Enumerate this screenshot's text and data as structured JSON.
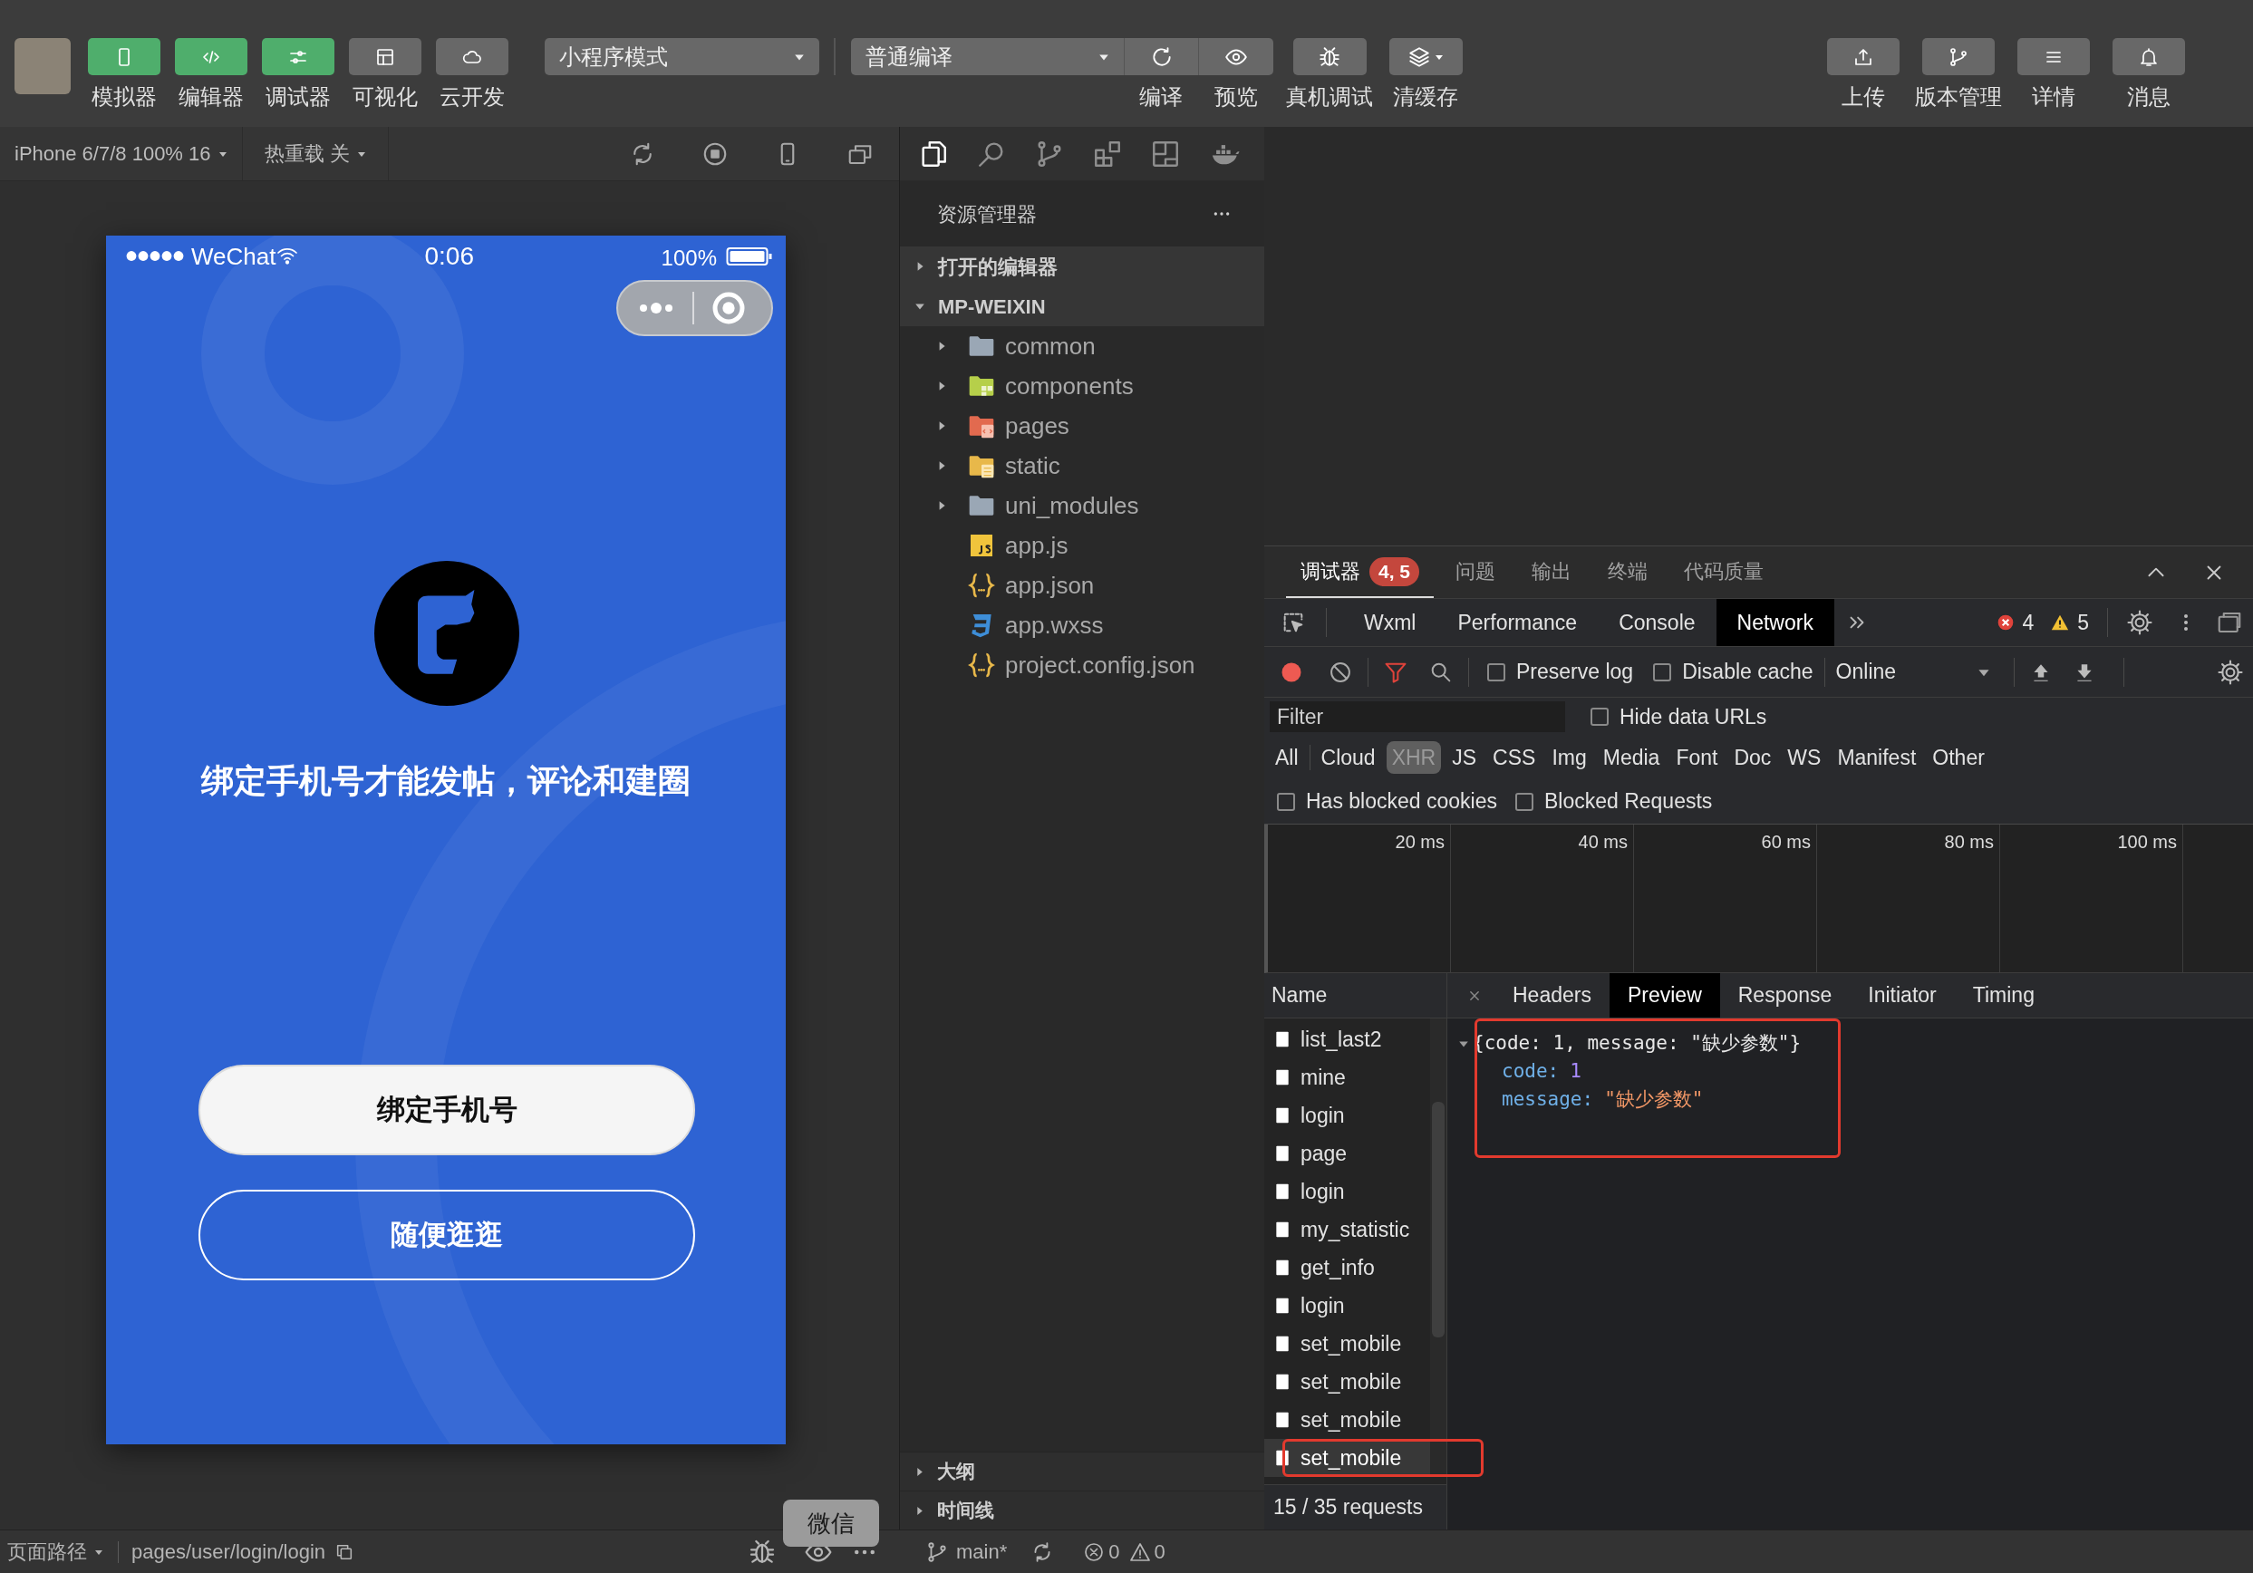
{
  "toolbar": {
    "view_buttons": [
      {
        "label": "模拟器",
        "on": true
      },
      {
        "label": "编辑器",
        "on": true
      },
      {
        "label": "调试器",
        "on": true
      },
      {
        "label": "可视化",
        "on": false
      },
      {
        "label": "云开发",
        "on": false
      }
    ],
    "mode_select": "小程序模式",
    "compile_select": "普通编译",
    "actions": [
      "编译",
      "预览",
      "真机调试",
      "清缓存"
    ],
    "right_buttons": [
      "上传",
      "版本管理",
      "详情",
      "消息"
    ]
  },
  "simulator": {
    "device": "iPhone 6/7/8 100% 16",
    "hot_reload": "热重载 关",
    "phone": {
      "carrier": "WeChat",
      "time": "0:06",
      "battery": "100%",
      "headline": "绑定手机号才能发帖，评论和建圈",
      "buttons": [
        {
          "label": "绑定手机号",
          "kind": "filled"
        },
        {
          "label": "随便逛逛",
          "kind": "outline"
        }
      ]
    }
  },
  "explorer": {
    "title": "资源管理器",
    "sections": [
      {
        "label": "打开的编辑器",
        "expanded": false
      },
      {
        "label": "MP-WEIXIN",
        "expanded": true,
        "children": [
          {
            "name": "common",
            "kind": "folder",
            "expanded": false
          },
          {
            "name": "components",
            "kind": "components-folder",
            "expanded": false
          },
          {
            "name": "pages",
            "kind": "pages-folder",
            "expanded": false
          },
          {
            "name": "static",
            "kind": "static-folder",
            "expanded": false
          },
          {
            "name": "uni_modules",
            "kind": "folder",
            "expanded": false
          },
          {
            "name": "app.js",
            "kind": "js"
          },
          {
            "name": "app.json",
            "kind": "json"
          },
          {
            "name": "app.wxss",
            "kind": "wxss"
          },
          {
            "name": "project.config.json",
            "kind": "json"
          }
        ]
      }
    ],
    "panels": [
      {
        "label": "大纲",
        "expanded": false
      },
      {
        "label": "时间线",
        "expanded": false
      }
    ]
  },
  "debugger": {
    "tabs": [
      {
        "label": "调试器",
        "selected": true,
        "badge": "4, 5"
      },
      {
        "label": "问题",
        "selected": false
      },
      {
        "label": "输出",
        "selected": false
      },
      {
        "label": "终端",
        "selected": false
      },
      {
        "label": "代码质量",
        "selected": false
      }
    ],
    "panel_tabs": [
      {
        "label": "Wxml",
        "selected": false
      },
      {
        "label": "Performance",
        "selected": false
      },
      {
        "label": "Console",
        "selected": false
      },
      {
        "label": "Network",
        "selected": true
      }
    ],
    "error_count": "4",
    "warning_count": "5",
    "network": {
      "recording": true,
      "toolbar_options": [
        {
          "label": "Preserve log",
          "checked": false
        },
        {
          "label": "Disable cache",
          "checked": false
        }
      ],
      "throttling": "Online",
      "filter": {
        "placeholder": "Filter"
      },
      "filter_options": [
        {
          "label": "Hide data URLs",
          "checked": false
        }
      ],
      "types": [
        {
          "label": "All",
          "selected": false
        },
        {
          "label": "Cloud",
          "selected": false
        },
        {
          "label": "XHR",
          "selected": true
        },
        {
          "label": "JS",
          "selected": false
        },
        {
          "label": "CSS",
          "selected": false
        },
        {
          "label": "Img",
          "selected": false
        },
        {
          "label": "Media",
          "selected": false
        },
        {
          "label": "Font",
          "selected": false
        },
        {
          "label": "Doc",
          "selected": false
        },
        {
          "label": "WS",
          "selected": false
        },
        {
          "label": "Manifest",
          "selected": false
        },
        {
          "label": "Other",
          "selected": false
        }
      ],
      "blocked_options": [
        {
          "label": "Has blocked cookies",
          "checked": false
        },
        {
          "label": "Blocked Requests",
          "checked": false
        }
      ],
      "timeline_ticks": [
        "20 ms",
        "40 ms",
        "60 ms",
        "80 ms",
        "100 ms"
      ],
      "name_column": "Name",
      "requests": [
        {
          "name": "list_last2",
          "selected": false,
          "highlighted": false
        },
        {
          "name": "mine",
          "selected": false,
          "highlighted": false
        },
        {
          "name": "login",
          "selected": false,
          "highlighted": false
        },
        {
          "name": "page",
          "selected": false,
          "highlighted": false
        },
        {
          "name": "login",
          "selected": false,
          "highlighted": false
        },
        {
          "name": "my_statistic",
          "selected": false,
          "highlighted": false
        },
        {
          "name": "get_info",
          "selected": false,
          "highlighted": false
        },
        {
          "name": "login",
          "selected": false,
          "highlighted": false
        },
        {
          "name": "set_mobile",
          "selected": false,
          "highlighted": false
        },
        {
          "name": "set_mobile",
          "selected": false,
          "highlighted": false
        },
        {
          "name": "set_mobile",
          "selected": false,
          "highlighted": false
        },
        {
          "name": "set_mobile",
          "selected": true,
          "highlighted": true
        }
      ],
      "summary": "15 / 35 requests",
      "detail_tabs": [
        {
          "label": "Headers",
          "selected": false
        },
        {
          "label": "Preview",
          "selected": true
        },
        {
          "label": "Response",
          "selected": false
        },
        {
          "label": "Initiator",
          "selected": false
        },
        {
          "label": "Timing",
          "selected": false
        }
      ],
      "preview": {
        "summary": "{code: 1, message: \"缺少参数\"}",
        "expanded": true,
        "highlighted": true,
        "fields": [
          {
            "key": "code:",
            "value": "1",
            "kind": "number"
          },
          {
            "key": "message:",
            "value": "\"缺少参数\"",
            "kind": "string"
          }
        ]
      }
    }
  },
  "status_bar": {
    "path_label": "页面路径",
    "path": "pages/user/login/login",
    "tooltip": "微信",
    "branch": "main*",
    "errors": "0",
    "warnings": "0"
  }
}
